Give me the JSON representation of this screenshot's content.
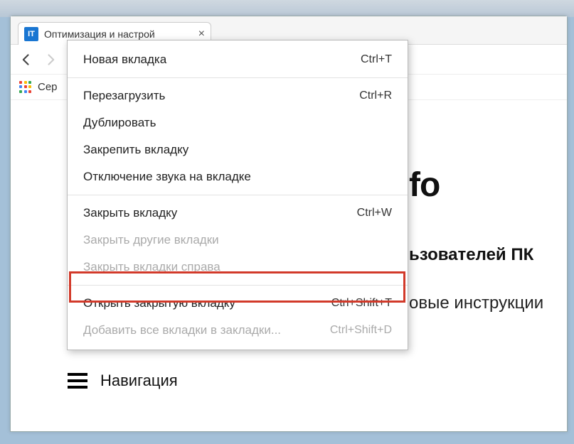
{
  "tab": {
    "favicon_text": "IT",
    "title": "Оптимизация и настрой"
  },
  "bookmarks": {
    "apps_label": "Сер"
  },
  "page": {
    "title_fragment": "fo",
    "subtitle_fragment_1": "ьзователей ПК",
    "subtitle_fragment_2": "овые инструкции",
    "navigation_label": "Навигация"
  },
  "context_menu": {
    "items": [
      {
        "label": "Новая вкладка",
        "shortcut": "Ctrl+T",
        "disabled": false
      },
      {
        "type": "separator"
      },
      {
        "label": "Перезагрузить",
        "shortcut": "Ctrl+R",
        "disabled": false
      },
      {
        "label": "Дублировать",
        "shortcut": "",
        "disabled": false
      },
      {
        "label": "Закрепить вкладку",
        "shortcut": "",
        "disabled": false
      },
      {
        "label": "Отключение звука на вкладке",
        "shortcut": "",
        "disabled": false
      },
      {
        "type": "separator"
      },
      {
        "label": "Закрыть вкладку",
        "shortcut": "Ctrl+W",
        "disabled": false
      },
      {
        "label": "Закрыть другие вкладки",
        "shortcut": "",
        "disabled": true
      },
      {
        "label": "Закрыть вкладки справа",
        "shortcut": "",
        "disabled": true
      },
      {
        "type": "separator"
      },
      {
        "label": "Открыть закрытую вкладку",
        "shortcut": "Ctrl+Shift+T",
        "disabled": false,
        "highlighted": true
      },
      {
        "label": "Добавить все вкладки в закладки...",
        "shortcut": "Ctrl+Shift+D",
        "disabled": true
      }
    ]
  }
}
